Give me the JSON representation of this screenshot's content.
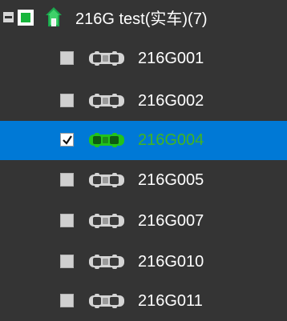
{
  "tree": {
    "group": {
      "label": "216G test(实车)(7)",
      "expanded": true,
      "checked": "partial",
      "icon": "home-icon",
      "colors": {
        "icon": "#1aa84c",
        "check": "#18b63d"
      }
    },
    "vehicles": [
      {
        "label": "216G001",
        "checked": false,
        "online": false
      },
      {
        "label": "216G002",
        "checked": false,
        "online": false
      },
      {
        "label": "216G004",
        "checked": true,
        "online": true,
        "selected": true
      },
      {
        "label": "216G005",
        "checked": false,
        "online": false
      },
      {
        "label": "216G007",
        "checked": false,
        "online": false
      },
      {
        "label": "216G010",
        "checked": false,
        "online": false
      },
      {
        "label": "216G011",
        "checked": false,
        "online": false
      }
    ],
    "colors": {
      "background": "#343434",
      "selected_row": "#0079d6",
      "online_text": "#42b51f",
      "online_car": "#22c31a",
      "offline_car": "#d4d4d4"
    }
  }
}
